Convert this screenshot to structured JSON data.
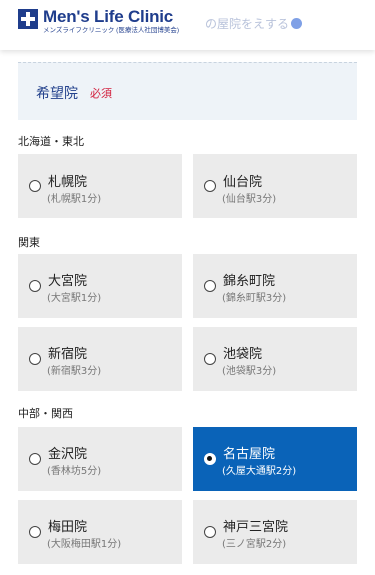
{
  "header": {
    "logo_main": "Men's Life Clinic",
    "logo_sub": "メンズライフクリニック (医療法人社団博美会)",
    "faded_text": "の屋院をえする",
    "cross_icon": "medical-cross-icon"
  },
  "question": {
    "label": "希望院",
    "required": "必須"
  },
  "regions": {
    "hokkaido_tohoku": "北海道・東北",
    "kanto": "関東",
    "chubu_kansai": "中部・関西"
  },
  "clinics": [
    {
      "name": "札幌院",
      "station": "(札幌駅1分)",
      "selected": false
    },
    {
      "name": "仙台院",
      "station": "(仙台駅3分)",
      "selected": false
    },
    {
      "name": "大宮院",
      "station": "(大宮駅1分)",
      "selected": false
    },
    {
      "name": "錦糸町院",
      "station": "(錦糸町駅3分)",
      "selected": false
    },
    {
      "name": "新宿院",
      "station": "(新宿駅3分)",
      "selected": false
    },
    {
      "name": "池袋院",
      "station": "(池袋駅3分)",
      "selected": false
    },
    {
      "name": "金沢院",
      "station": "(香林坊5分)",
      "selected": false
    },
    {
      "name": "名古屋院",
      "station": "(久屋大通駅2分)",
      "selected": true
    },
    {
      "name": "梅田院",
      "station": "(大阪梅田駅1分)",
      "selected": false
    },
    {
      "name": "神戸三宮院",
      "station": "(三ノ宮駅2分)",
      "selected": false
    }
  ],
  "colors": {
    "brand": "#1f3d8c",
    "selected": "#0a63b8",
    "required": "#d21e3c",
    "card_bg": "#ebebeb"
  }
}
